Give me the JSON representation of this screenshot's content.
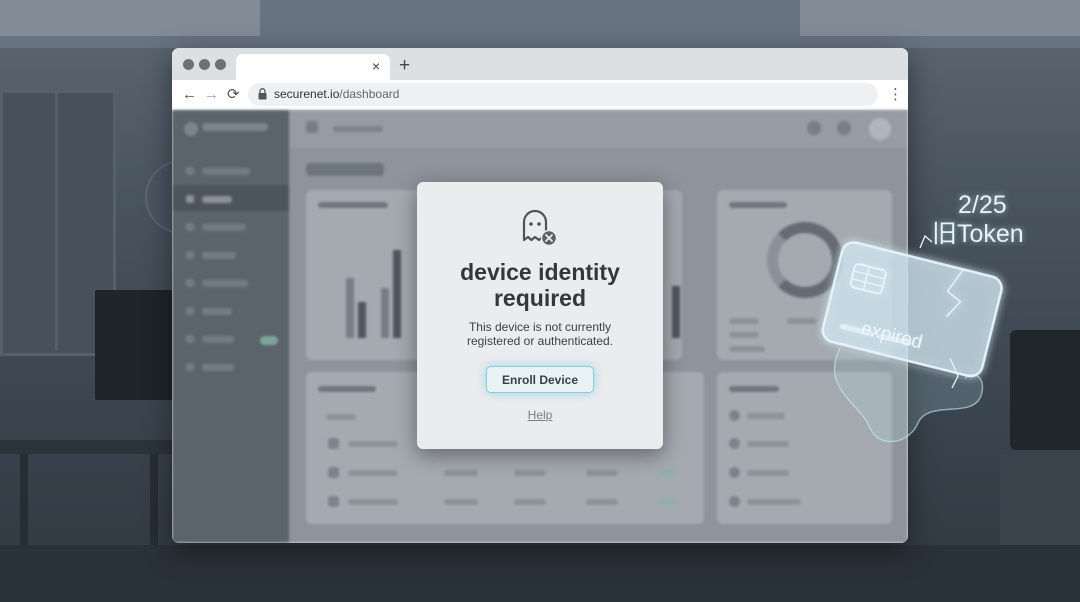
{
  "browser": {
    "tab_close": "×",
    "new_tab": "+",
    "url_domain": "securenet.io",
    "url_path": "/dashboard",
    "back": "←",
    "forward": "→",
    "reload": "⟳",
    "menu": "⋮"
  },
  "modal": {
    "icon": "ghost-warning-icon",
    "title_line1": "device identity",
    "title_line2": "required",
    "body_line1": "This device is not currently",
    "body_line2": "registered or authenticated.",
    "primary_label": "Enroll Device",
    "help_label": "Help"
  },
  "token_overlay": {
    "date": "2/25",
    "name": "旧Token",
    "status": "expired",
    "glow_color": "#bfe3f0"
  },
  "colors": {
    "accent": "#8cc9d9",
    "modal_bg": "#eaecee"
  }
}
